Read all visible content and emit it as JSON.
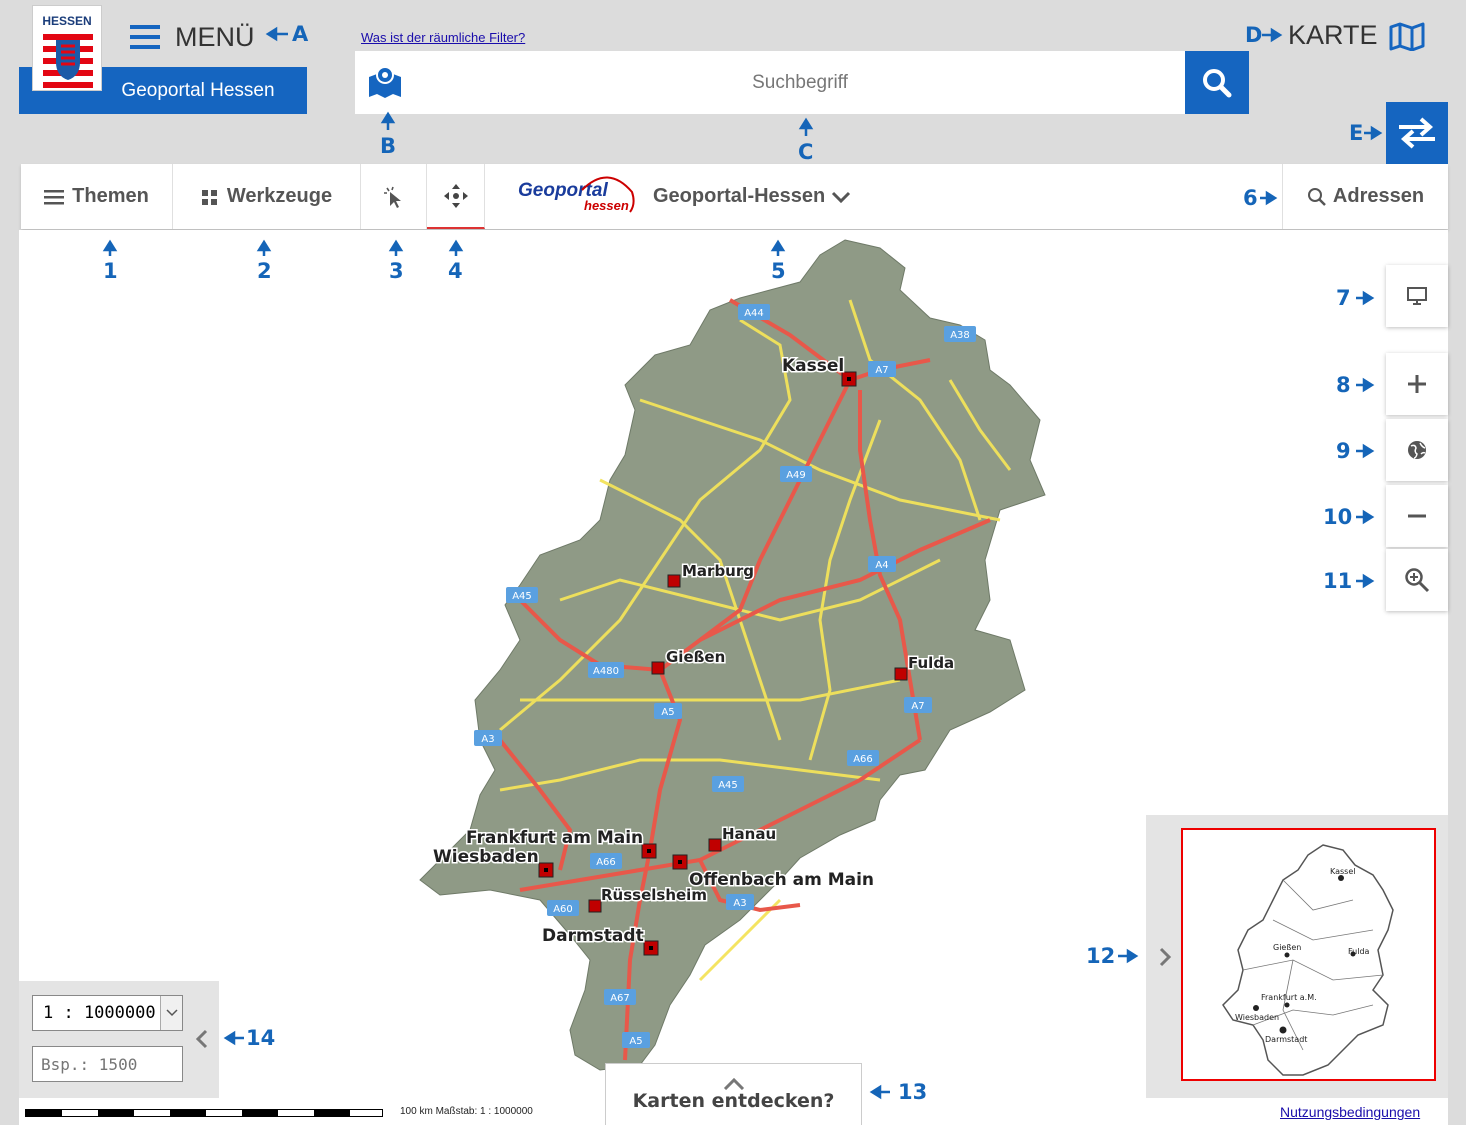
{
  "header": {
    "logo_text": "HESSEN",
    "portal_button": "Geoportal Hessen",
    "menu_label": "MENÜ",
    "filter_link": "Was ist der räumliche Filter?",
    "search_placeholder": "Suchbegriff",
    "karte_label": "KARTE"
  },
  "toolbar": {
    "themen": "Themen",
    "werkzeuge": "Werkzeuge",
    "logo_main": "Geoportal",
    "logo_sub": "hessen",
    "layer_select": "Geoportal-Hessen",
    "adressen": "Adressen"
  },
  "map": {
    "cities": {
      "kassel": "Kassel",
      "marburg": "Marburg",
      "giessen": "Gießen",
      "fulda": "Fulda",
      "frankfurt": "Frankfurt am Main",
      "wiesbaden": "Wiesbaden",
      "hanau": "Hanau",
      "offenbach": "Offenbach am Main",
      "ruesselsheim": "Rüsselsheim",
      "darmstadt": "Darmstadt"
    },
    "highways": {
      "a44": "A44",
      "a38": "A38",
      "a7_north": "A7",
      "a49": "A49",
      "a4": "A4",
      "a45_west": "A45",
      "a480": "A480",
      "a5_mid": "A5",
      "a7_south": "A7",
      "a3_west": "A3",
      "a66_east": "A66",
      "a45_south": "A45",
      "a66_west": "A66",
      "a60": "A60",
      "a3_south": "A3",
      "a67": "A67",
      "a5_south": "A5"
    },
    "colors": {
      "terrain": "#8f9a86",
      "road_major": "#e8584a",
      "road_minor": "#f3e35a",
      "city_marker": "#c00000"
    }
  },
  "overview": {
    "cities": {
      "kassel": "Kassel",
      "giessen": "Gießen",
      "fulda": "Fulda",
      "frankfurt": "Frankfurt a.M.",
      "wiesbaden": "Wiesbaden",
      "darmstadt": "Darmstadt"
    }
  },
  "scale": {
    "selected": "1 : 1000000",
    "input_placeholder": "Bsp.: 1500",
    "bar_text": "100 km  Maßstab: 1 : 1000000"
  },
  "discover_label": "Karten entdecken?",
  "terms_link": "Nutzungsbedingungen",
  "callouts": {
    "A": "A",
    "B": "B",
    "C": "C",
    "D": "D",
    "E": "E",
    "n1": "1",
    "n2": "2",
    "n3": "3",
    "n4": "4",
    "n5": "5",
    "n6": "6",
    "n7": "7",
    "n8": "8",
    "n9": "9",
    "n10": "10",
    "n11": "11",
    "n12": "12",
    "n13": "13",
    "n14": "14"
  },
  "icons": {
    "burger": "menu-icon",
    "search": "search-icon",
    "map": "map-icon",
    "swap": "swap-icon",
    "monitor": "monitor-icon",
    "plus": "zoom-in-icon",
    "globe": "globe-icon",
    "minus": "zoom-out-icon",
    "zoom_rect": "zoom-rectangle-icon"
  }
}
